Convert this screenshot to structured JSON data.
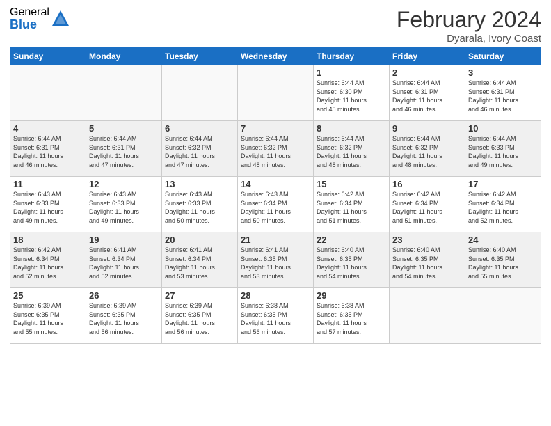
{
  "logo": {
    "general": "General",
    "blue": "Blue"
  },
  "title": "February 2024",
  "location": "Dyarala, Ivory Coast",
  "days_of_week": [
    "Sunday",
    "Monday",
    "Tuesday",
    "Wednesday",
    "Thursday",
    "Friday",
    "Saturday"
  ],
  "weeks": [
    [
      {
        "day": "",
        "info": "",
        "empty": true
      },
      {
        "day": "",
        "info": "",
        "empty": true
      },
      {
        "day": "",
        "info": "",
        "empty": true
      },
      {
        "day": "",
        "info": "",
        "empty": true
      },
      {
        "day": "1",
        "info": "Sunrise: 6:44 AM\nSunset: 6:30 PM\nDaylight: 11 hours\nand 45 minutes."
      },
      {
        "day": "2",
        "info": "Sunrise: 6:44 AM\nSunset: 6:31 PM\nDaylight: 11 hours\nand 46 minutes."
      },
      {
        "day": "3",
        "info": "Sunrise: 6:44 AM\nSunset: 6:31 PM\nDaylight: 11 hours\nand 46 minutes."
      }
    ],
    [
      {
        "day": "4",
        "info": "Sunrise: 6:44 AM\nSunset: 6:31 PM\nDaylight: 11 hours\nand 46 minutes.",
        "shaded": true
      },
      {
        "day": "5",
        "info": "Sunrise: 6:44 AM\nSunset: 6:31 PM\nDaylight: 11 hours\nand 47 minutes.",
        "shaded": true
      },
      {
        "day": "6",
        "info": "Sunrise: 6:44 AM\nSunset: 6:32 PM\nDaylight: 11 hours\nand 47 minutes.",
        "shaded": true
      },
      {
        "day": "7",
        "info": "Sunrise: 6:44 AM\nSunset: 6:32 PM\nDaylight: 11 hours\nand 48 minutes.",
        "shaded": true
      },
      {
        "day": "8",
        "info": "Sunrise: 6:44 AM\nSunset: 6:32 PM\nDaylight: 11 hours\nand 48 minutes.",
        "shaded": true
      },
      {
        "day": "9",
        "info": "Sunrise: 6:44 AM\nSunset: 6:32 PM\nDaylight: 11 hours\nand 48 minutes.",
        "shaded": true
      },
      {
        "day": "10",
        "info": "Sunrise: 6:44 AM\nSunset: 6:33 PM\nDaylight: 11 hours\nand 49 minutes.",
        "shaded": true
      }
    ],
    [
      {
        "day": "11",
        "info": "Sunrise: 6:43 AM\nSunset: 6:33 PM\nDaylight: 11 hours\nand 49 minutes."
      },
      {
        "day": "12",
        "info": "Sunrise: 6:43 AM\nSunset: 6:33 PM\nDaylight: 11 hours\nand 49 minutes."
      },
      {
        "day": "13",
        "info": "Sunrise: 6:43 AM\nSunset: 6:33 PM\nDaylight: 11 hours\nand 50 minutes."
      },
      {
        "day": "14",
        "info": "Sunrise: 6:43 AM\nSunset: 6:34 PM\nDaylight: 11 hours\nand 50 minutes."
      },
      {
        "day": "15",
        "info": "Sunrise: 6:42 AM\nSunset: 6:34 PM\nDaylight: 11 hours\nand 51 minutes."
      },
      {
        "day": "16",
        "info": "Sunrise: 6:42 AM\nSunset: 6:34 PM\nDaylight: 11 hours\nand 51 minutes."
      },
      {
        "day": "17",
        "info": "Sunrise: 6:42 AM\nSunset: 6:34 PM\nDaylight: 11 hours\nand 52 minutes."
      }
    ],
    [
      {
        "day": "18",
        "info": "Sunrise: 6:42 AM\nSunset: 6:34 PM\nDaylight: 11 hours\nand 52 minutes.",
        "shaded": true
      },
      {
        "day": "19",
        "info": "Sunrise: 6:41 AM\nSunset: 6:34 PM\nDaylight: 11 hours\nand 52 minutes.",
        "shaded": true
      },
      {
        "day": "20",
        "info": "Sunrise: 6:41 AM\nSunset: 6:34 PM\nDaylight: 11 hours\nand 53 minutes.",
        "shaded": true
      },
      {
        "day": "21",
        "info": "Sunrise: 6:41 AM\nSunset: 6:35 PM\nDaylight: 11 hours\nand 53 minutes.",
        "shaded": true
      },
      {
        "day": "22",
        "info": "Sunrise: 6:40 AM\nSunset: 6:35 PM\nDaylight: 11 hours\nand 54 minutes.",
        "shaded": true
      },
      {
        "day": "23",
        "info": "Sunrise: 6:40 AM\nSunset: 6:35 PM\nDaylight: 11 hours\nand 54 minutes.",
        "shaded": true
      },
      {
        "day": "24",
        "info": "Sunrise: 6:40 AM\nSunset: 6:35 PM\nDaylight: 11 hours\nand 55 minutes.",
        "shaded": true
      }
    ],
    [
      {
        "day": "25",
        "info": "Sunrise: 6:39 AM\nSunset: 6:35 PM\nDaylight: 11 hours\nand 55 minutes."
      },
      {
        "day": "26",
        "info": "Sunrise: 6:39 AM\nSunset: 6:35 PM\nDaylight: 11 hours\nand 56 minutes."
      },
      {
        "day": "27",
        "info": "Sunrise: 6:39 AM\nSunset: 6:35 PM\nDaylight: 11 hours\nand 56 minutes."
      },
      {
        "day": "28",
        "info": "Sunrise: 6:38 AM\nSunset: 6:35 PM\nDaylight: 11 hours\nand 56 minutes."
      },
      {
        "day": "29",
        "info": "Sunrise: 6:38 AM\nSunset: 6:35 PM\nDaylight: 11 hours\nand 57 minutes."
      },
      {
        "day": "",
        "info": "",
        "empty": true
      },
      {
        "day": "",
        "info": "",
        "empty": true
      }
    ]
  ]
}
